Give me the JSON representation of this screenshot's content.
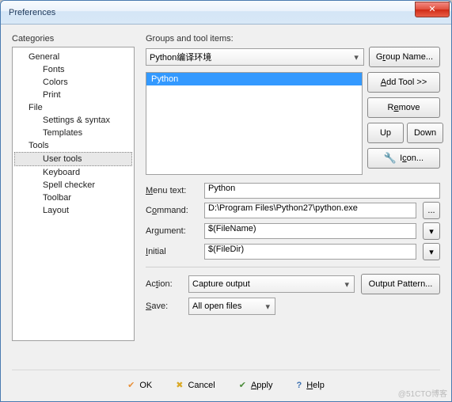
{
  "window": {
    "title": "Preferences"
  },
  "categories": {
    "label": "Categories",
    "items": [
      {
        "label": "General",
        "level": 1
      },
      {
        "label": "Fonts",
        "level": 2
      },
      {
        "label": "Colors",
        "level": 2
      },
      {
        "label": "Print",
        "level": 2
      },
      {
        "label": "File",
        "level": 1
      },
      {
        "label": "Settings & syntax",
        "level": 2
      },
      {
        "label": "Templates",
        "level": 2
      },
      {
        "label": "Tools",
        "level": 1
      },
      {
        "label": "User tools",
        "level": 2,
        "selected": true
      },
      {
        "label": "Keyboard",
        "level": 2
      },
      {
        "label": "Spell checker",
        "level": 2
      },
      {
        "label": "Toolbar",
        "level": 2
      },
      {
        "label": "Layout",
        "level": 2
      }
    ]
  },
  "groups": {
    "label": "Groups and tool items:",
    "combo_value": "Python编译环境",
    "group_name_btn": "Group Name...",
    "add_tool_btn": "Add Tool >>",
    "remove_btn": "Remove",
    "up_btn": "Up",
    "down_btn": "Down",
    "icon_btn": "Icon...",
    "list_items": [
      "Python"
    ]
  },
  "form": {
    "menu_text_label": "Menu text:",
    "menu_text_value": "Python",
    "command_label": "Command:",
    "command_value": "D:\\Program Files\\Python27\\python.exe",
    "argument_label": "Argument:",
    "argument_value": "$(FileName)",
    "initial_label": "Initial",
    "initial_value": "$(FileDir)",
    "action_label": "Action:",
    "action_value": "Capture output",
    "output_pattern_btn": "Output Pattern...",
    "save_label": "Save:",
    "save_value": "All open files"
  },
  "footer": {
    "ok": "OK",
    "cancel": "Cancel",
    "apply": "Apply",
    "help": "Help"
  },
  "watermark": "@51CTO博客"
}
